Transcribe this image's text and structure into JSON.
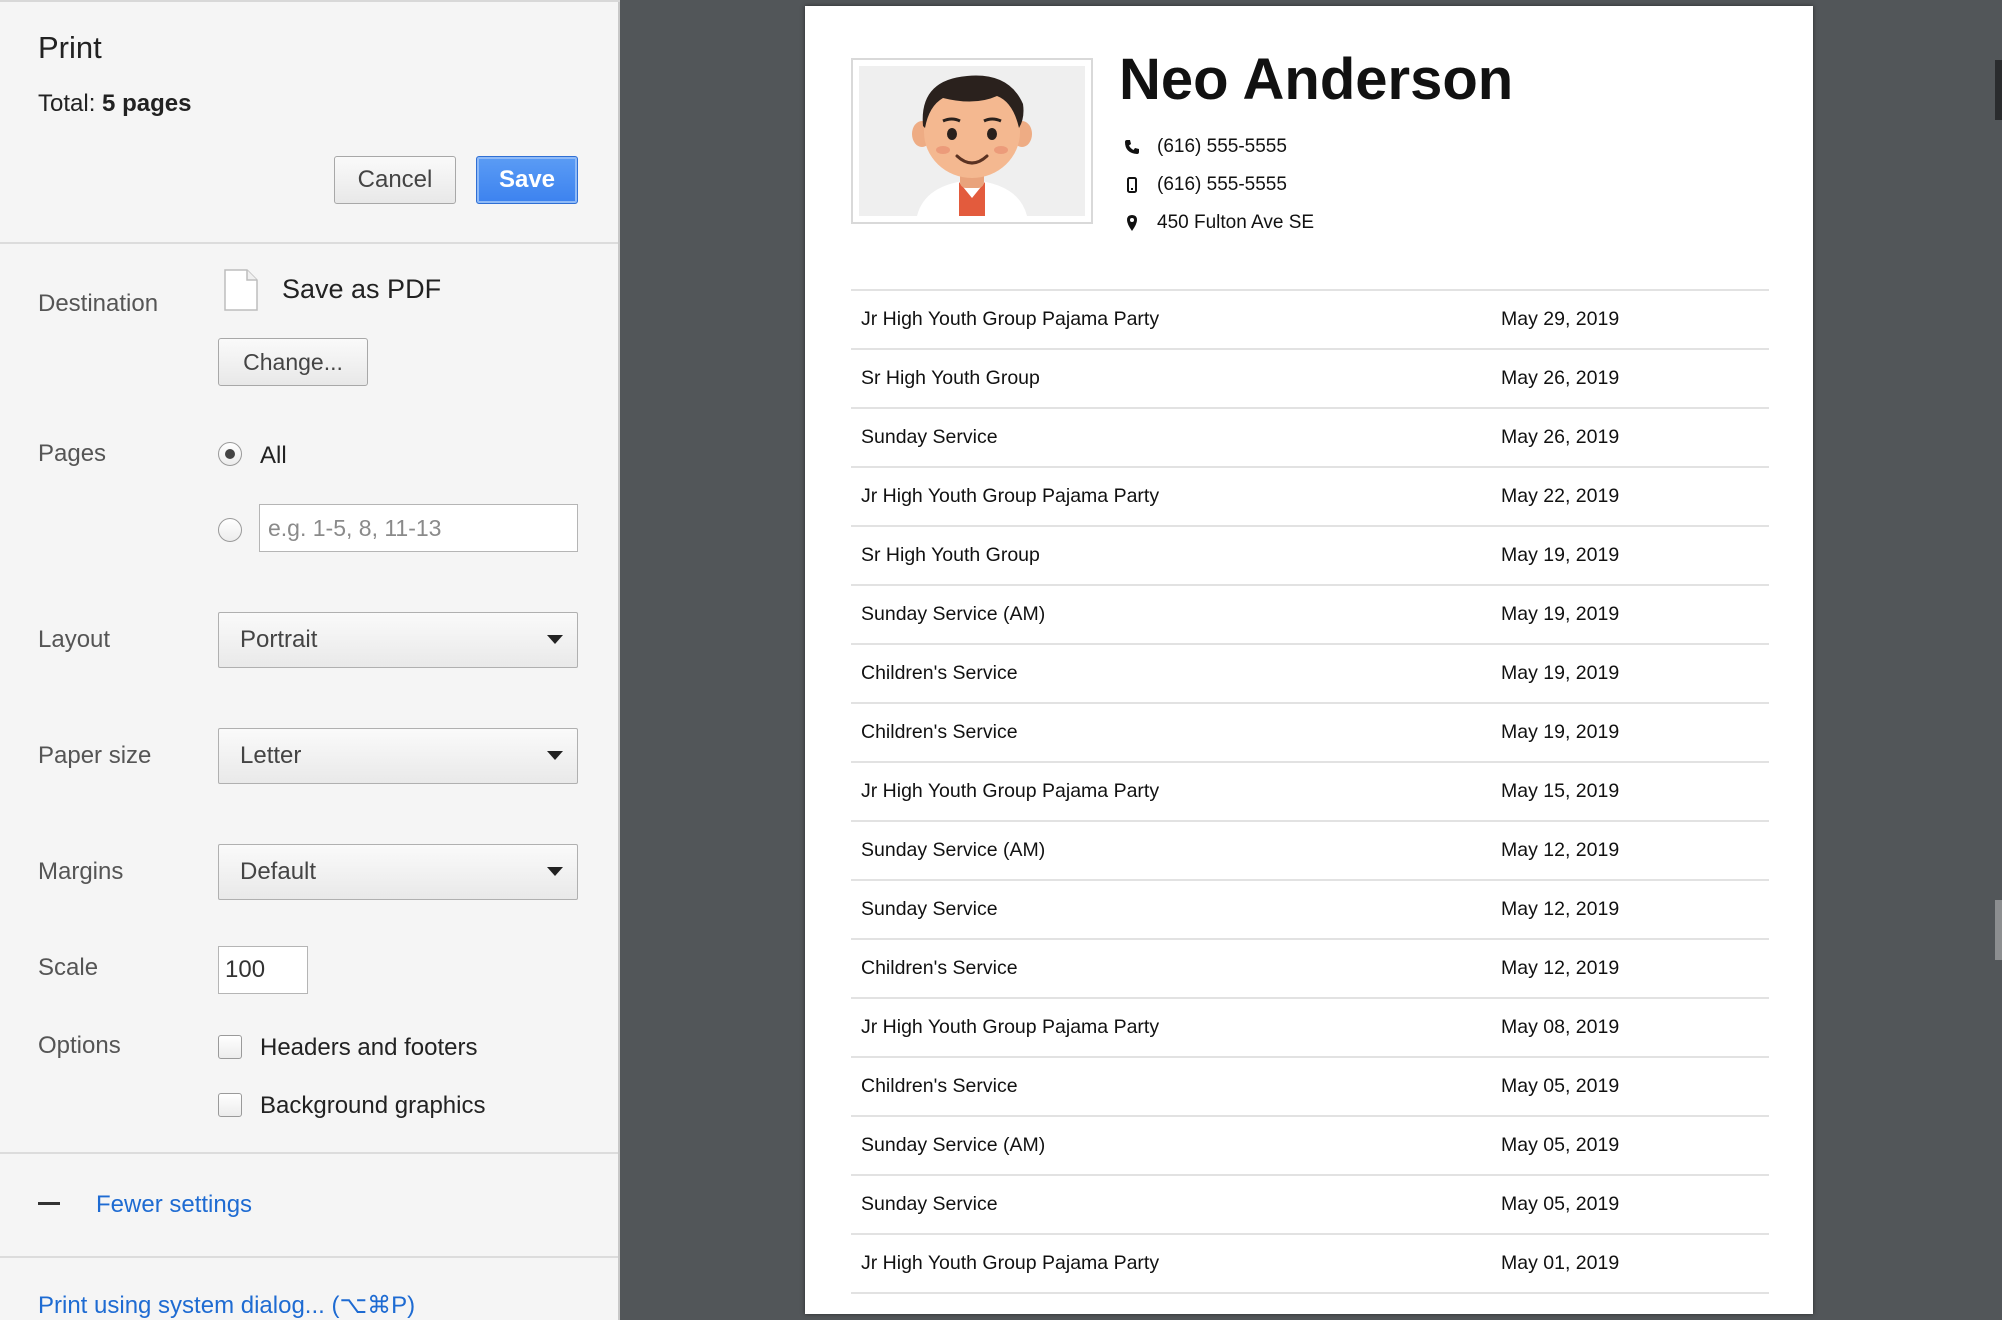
{
  "print_panel": {
    "title": "Print",
    "total_label": "Total:",
    "total_value": "5 pages",
    "cancel_label": "Cancel",
    "save_label": "Save",
    "destination": {
      "label": "Destination",
      "value": "Save as PDF",
      "change_label": "Change..."
    },
    "pages": {
      "label": "Pages",
      "all_label": "All",
      "selected": "all",
      "custom_placeholder": "e.g. 1-5, 8, 11-13"
    },
    "layout": {
      "label": "Layout",
      "value": "Portrait"
    },
    "paper_size": {
      "label": "Paper size",
      "value": "Letter"
    },
    "margins": {
      "label": "Margins",
      "value": "Default"
    },
    "scale": {
      "label": "Scale",
      "value": "100"
    },
    "options": {
      "label": "Options",
      "headers_footers": {
        "label": "Headers and footers",
        "checked": false
      },
      "background_graphics": {
        "label": "Background graphics",
        "checked": false
      }
    },
    "fewer_settings_label": "Fewer settings",
    "system_dialog_label": "Print using system dialog... (⌥⌘P)"
  },
  "preview": {
    "person": {
      "name": "Neo Anderson",
      "phone": "(616) 555-5555",
      "mobile": "(616) 555-5555",
      "address": "450 Fulton Ave SE"
    },
    "events": [
      {
        "name": "Jr High Youth Group Pajama Party",
        "date": "May 29, 2019"
      },
      {
        "name": "Sr High Youth Group",
        "date": "May 26, 2019"
      },
      {
        "name": "Sunday Service",
        "date": "May 26, 2019"
      },
      {
        "name": "Jr High Youth Group Pajama Party",
        "date": "May 22, 2019"
      },
      {
        "name": "Sr High Youth Group",
        "date": "May 19, 2019"
      },
      {
        "name": "Sunday Service (AM)",
        "date": "May 19, 2019"
      },
      {
        "name": "Children's Service",
        "date": "May 19, 2019"
      },
      {
        "name": "Children's Service",
        "date": "May 19, 2019"
      },
      {
        "name": "Jr High Youth Group Pajama Party",
        "date": "May 15, 2019"
      },
      {
        "name": "Sunday Service (AM)",
        "date": "May 12, 2019"
      },
      {
        "name": "Sunday Service",
        "date": "May 12, 2019"
      },
      {
        "name": "Children's Service",
        "date": "May 12, 2019"
      },
      {
        "name": "Jr High Youth Group Pajama Party",
        "date": "May 08, 2019"
      },
      {
        "name": "Children's Service",
        "date": "May 05, 2019"
      },
      {
        "name": "Sunday Service (AM)",
        "date": "May 05, 2019"
      },
      {
        "name": "Sunday Service",
        "date": "May 05, 2019"
      },
      {
        "name": "Jr High Youth Group Pajama Party",
        "date": "May 01, 2019"
      }
    ]
  },
  "colors": {
    "panel_bg": "#f5f5f5",
    "preview_bg": "#525659",
    "save_button": "#3c82ef",
    "link": "#1e6bd2"
  },
  "icons": [
    "document-icon",
    "chevron-down-icon",
    "minus-icon",
    "phone-icon",
    "mobile-icon",
    "location-pin-icon",
    "avatar-photo"
  ]
}
